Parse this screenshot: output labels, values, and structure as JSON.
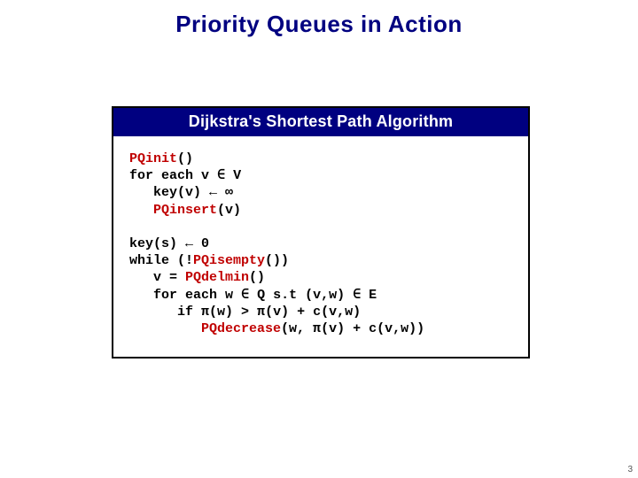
{
  "title": "Priority Queues in Action",
  "box_header": "Dijkstra's Shortest Path Algorithm",
  "sym": {
    "in": "∈",
    "larr": "←",
    "inf": "∞",
    "pi": "π"
  },
  "kw": {
    "PQinit": "PQinit",
    "PQinsert": "PQinsert",
    "PQisempty": "PQisempty",
    "PQdelmin": "PQdelmin",
    "PQdecrease": "PQdecrease"
  },
  "code": {
    "l1a": "()",
    "l2a": "for each v ",
    "l2b": " V",
    "l3a": "   key(v) ",
    "l3b": " ",
    "l4a": "   ",
    "l4b": "(v)",
    "blank": "",
    "l5a": "key(s) ",
    "l5b": " 0",
    "l6a": "while (!",
    "l6b": "())",
    "l7a": "   v = ",
    "l7b": "()",
    "l8a": "   for each w ",
    "l8b": " Q s.t (v,w) ",
    "l8c": " E",
    "l9a": "      if ",
    "l9b": "(w) > ",
    "l9c": "(v) + c(v,w)",
    "l10a": "         ",
    "l10b": "(w, ",
    "l10c": "(v) + c(v,w))"
  },
  "page_number": "3"
}
